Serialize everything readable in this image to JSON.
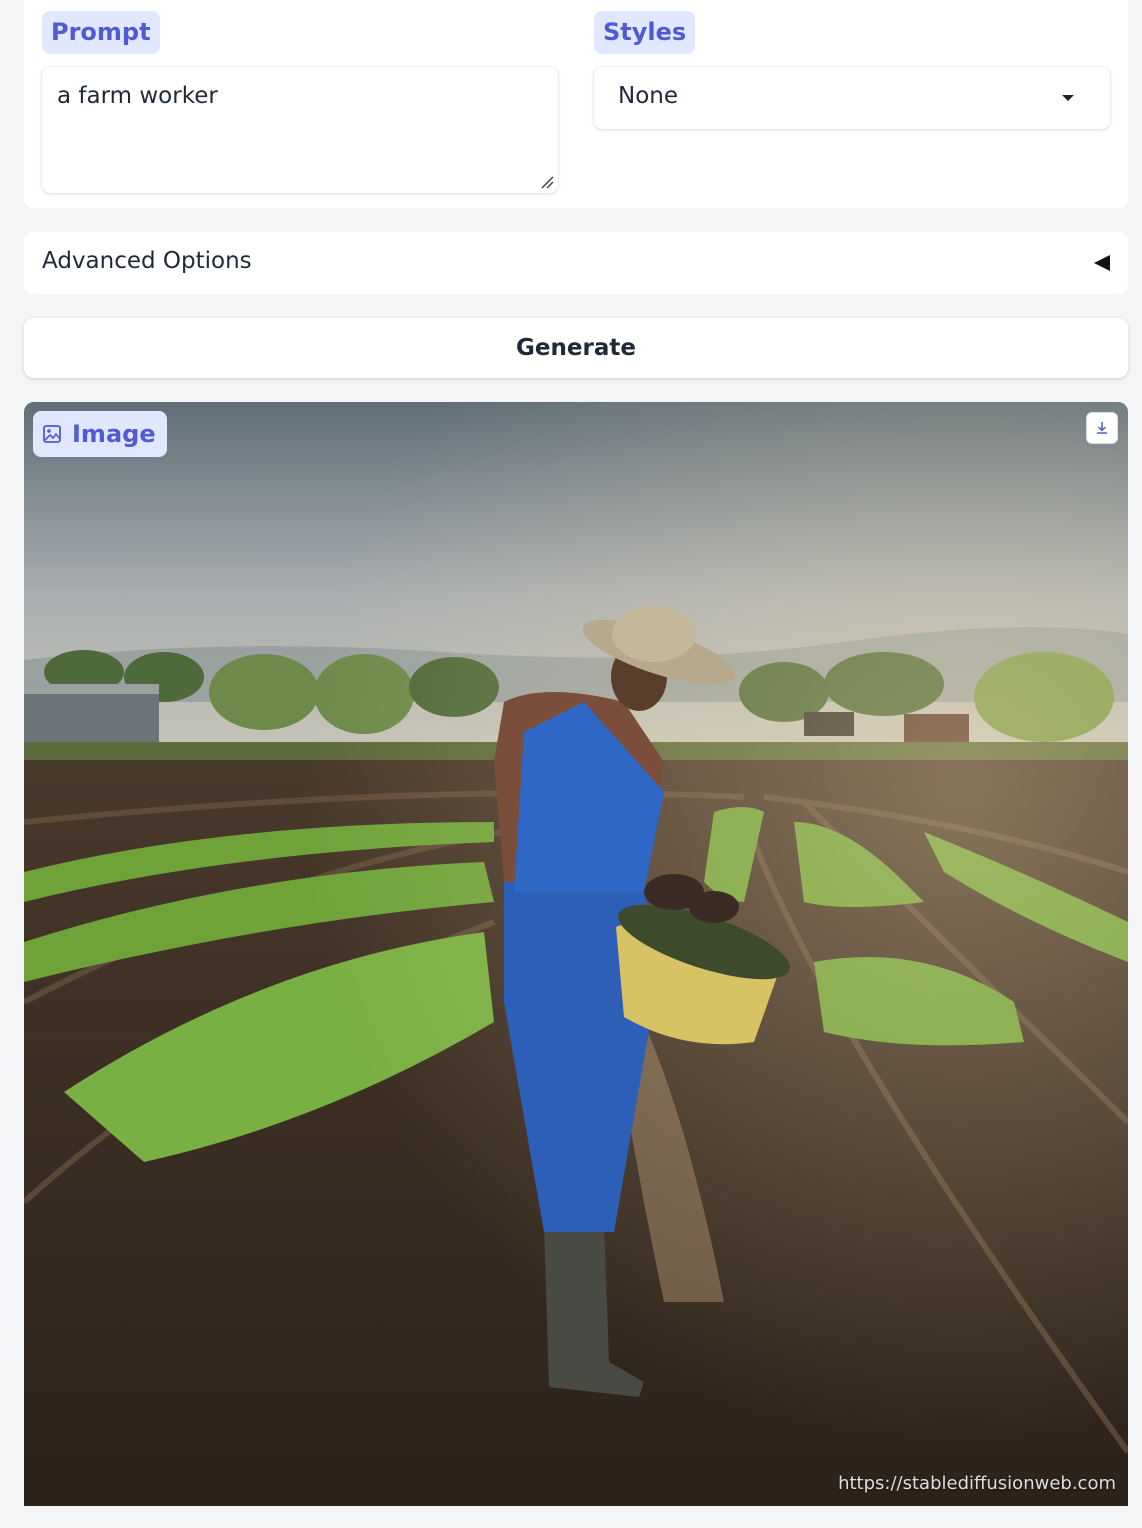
{
  "prompt": {
    "label": "Prompt",
    "value": "a farm worker"
  },
  "styles": {
    "label": "Styles",
    "selected": "None"
  },
  "advanced": {
    "label": "Advanced Options"
  },
  "generate": {
    "label": "Generate"
  },
  "output": {
    "label": "Image",
    "watermark": "https://stablediffusionweb.com",
    "icons": {
      "label_icon": "image-icon",
      "download": "download-icon"
    }
  },
  "colors": {
    "accent": "#4f5bd5",
    "chip_bg": "#e0e7ff",
    "card_bg": "#ffffff",
    "page_bg": "#f4f5f7"
  }
}
